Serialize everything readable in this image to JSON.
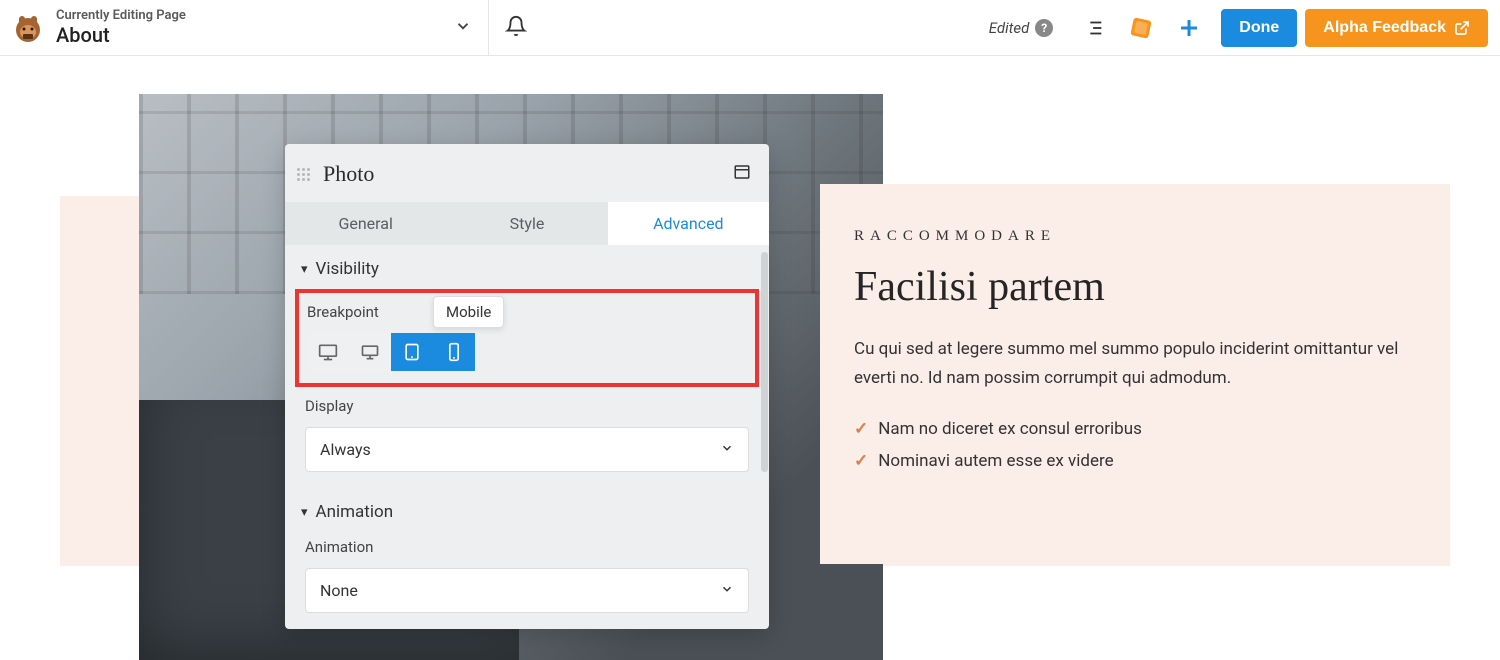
{
  "topbar": {
    "page_label": "Currently Editing Page",
    "page_title": "About",
    "edited_label": "Edited",
    "done_label": "Done",
    "feedback_label": "Alpha Feedback"
  },
  "content": {
    "eyebrow": "RACCOMMODARE",
    "headline": "Facilisi partem",
    "body": "Cu qui sed at legere summo mel summo populo inciderint omittantur vel everti no. Id nam possim corrumpit qui admodum.",
    "bullets": [
      "Nam no diceret ex consul erroribus",
      "Nominavi autem esse ex videre"
    ]
  },
  "panel": {
    "title": "Photo",
    "tabs": {
      "general": "General",
      "style": "Style",
      "advanced": "Advanced"
    },
    "sections": {
      "visibility": {
        "label": "Visibility",
        "breakpoint_label": "Breakpoint",
        "tooltip": "Mobile",
        "display_label": "Display",
        "display_value": "Always"
      },
      "animation": {
        "label": "Animation",
        "field_label": "Animation",
        "field_value": "None"
      }
    }
  }
}
